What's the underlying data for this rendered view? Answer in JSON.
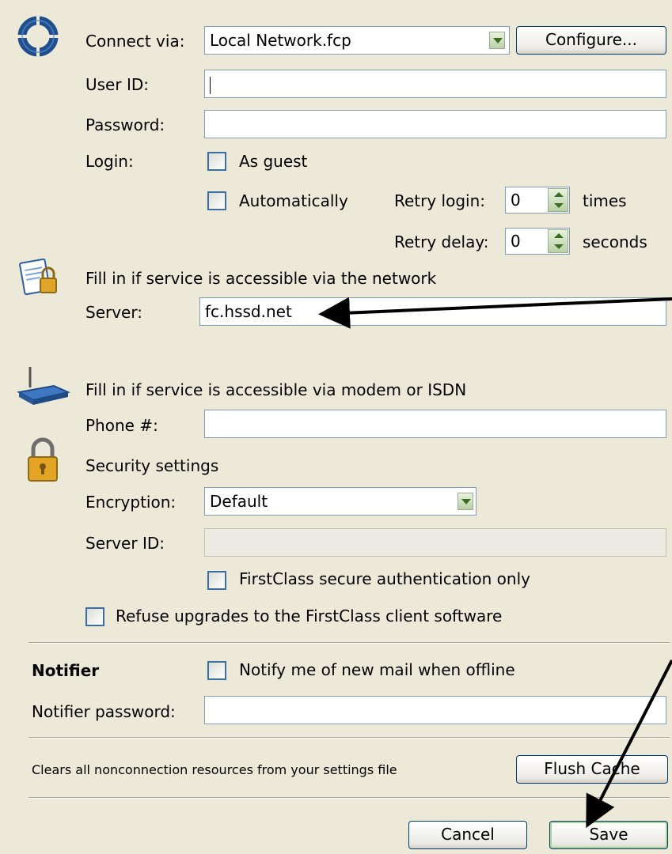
{
  "connection": {
    "connect_via_label": "Connect via:",
    "connect_via_value": "Local Network.fcp",
    "configure_button": "Configure...",
    "user_id_label": "User ID:",
    "user_id_value": "",
    "password_label": "Password:",
    "password_value": "",
    "login_label": "Login:",
    "as_guest_label": "As guest",
    "automatically_label": "Automatically",
    "retry_login_label": "Retry login:",
    "retry_login_value": "0",
    "retry_login_unit": "times",
    "retry_delay_label": "Retry delay:",
    "retry_delay_value": "0",
    "retry_delay_unit": "seconds"
  },
  "network": {
    "heading": "Fill in if service is accessible via the network",
    "server_label": "Server:",
    "server_value": "fc.hssd.net"
  },
  "modem": {
    "heading": "Fill in if service is accessible via modem or ISDN",
    "phone_label": "Phone #:",
    "phone_value": ""
  },
  "security": {
    "heading": "Security settings",
    "encryption_label": "Encryption:",
    "encryption_value": "Default",
    "server_id_label": "Server ID:",
    "server_id_value": "",
    "secure_auth_label": "FirstClass secure authentication only",
    "refuse_upgrades_label": "Refuse upgrades to the FirstClass client software"
  },
  "notifier": {
    "heading": "Notifier",
    "notify_label": "Notify me of new mail when offline",
    "password_label": "Notifier password:",
    "password_value": ""
  },
  "cache": {
    "description": "Clears all nonconnection resources from your settings file",
    "flush_button": "Flush Cache"
  },
  "footer": {
    "cancel_button": "Cancel",
    "save_button": "Save"
  },
  "icons": [
    "connection-ring-icon",
    "network-document-lock-icon",
    "modem-router-icon",
    "padlock-icon",
    "dropdown-arrow-icon",
    "spinner-icon"
  ]
}
